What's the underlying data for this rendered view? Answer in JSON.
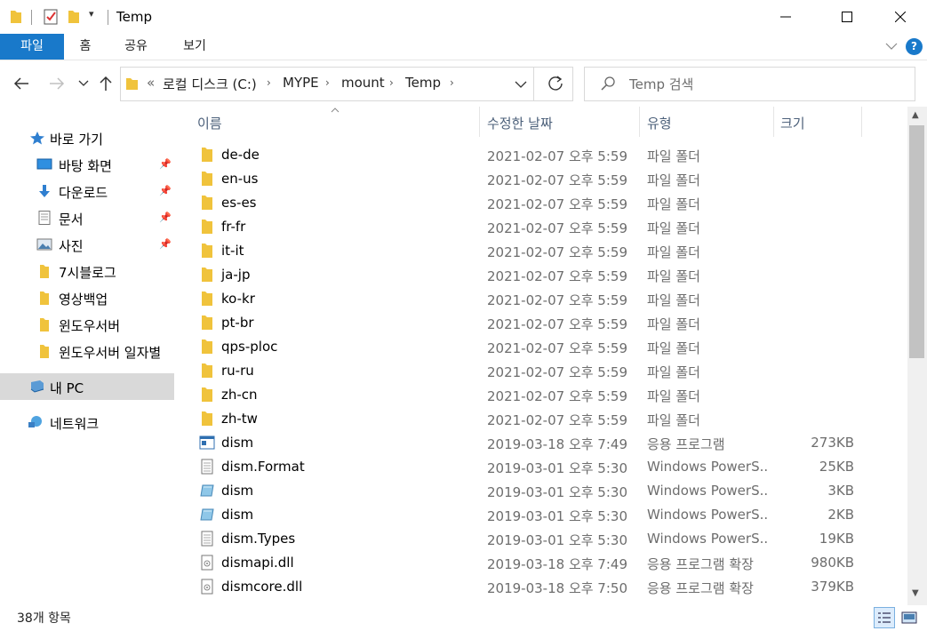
{
  "window": {
    "title": "Temp"
  },
  "ribbon": {
    "tabs": [
      "파일",
      "홈",
      "공유",
      "보기"
    ],
    "help": "?"
  },
  "address": {
    "overflow": "«",
    "crumbs": [
      "로컬 디스크 (C:)",
      "MYPE",
      "mount",
      "Temp"
    ]
  },
  "search": {
    "placeholder": "Temp 검색"
  },
  "sidebar": {
    "items": [
      {
        "label": "바로 가기",
        "icon": "star-icon",
        "pinned": false
      },
      {
        "label": "바탕 화면",
        "icon": "desktop-icon",
        "pinned": true
      },
      {
        "label": "다운로드",
        "icon": "download-icon",
        "pinned": true
      },
      {
        "label": "문서",
        "icon": "document-icon",
        "pinned": true
      },
      {
        "label": "사진",
        "icon": "picture-icon",
        "pinned": true
      },
      {
        "label": "7시블로그",
        "icon": "folder-icon",
        "pinned": false
      },
      {
        "label": "영상백업",
        "icon": "folder-icon",
        "pinned": false
      },
      {
        "label": "윈도우서버",
        "icon": "folder-icon",
        "pinned": false
      },
      {
        "label": "윈도우서버 일자별",
        "icon": "folder-icon",
        "pinned": false
      },
      {
        "label": "내 PC",
        "icon": "computer-icon",
        "pinned": false
      },
      {
        "label": "네트워크",
        "icon": "network-icon",
        "pinned": false
      }
    ]
  },
  "columns": {
    "name": "이름",
    "date": "수정한 날짜",
    "type": "유형",
    "size": "크기"
  },
  "files": [
    {
      "name": "de-de",
      "date": "2021-02-07 오후 5:59",
      "type": "파일 폴더",
      "size": "",
      "icon": "folder-icon"
    },
    {
      "name": "en-us",
      "date": "2021-02-07 오후 5:59",
      "type": "파일 폴더",
      "size": "",
      "icon": "folder-icon"
    },
    {
      "name": "es-es",
      "date": "2021-02-07 오후 5:59",
      "type": "파일 폴더",
      "size": "",
      "icon": "folder-icon"
    },
    {
      "name": "fr-fr",
      "date": "2021-02-07 오후 5:59",
      "type": "파일 폴더",
      "size": "",
      "icon": "folder-icon"
    },
    {
      "name": "it-it",
      "date": "2021-02-07 오후 5:59",
      "type": "파일 폴더",
      "size": "",
      "icon": "folder-icon"
    },
    {
      "name": "ja-jp",
      "date": "2021-02-07 오후 5:59",
      "type": "파일 폴더",
      "size": "",
      "icon": "folder-icon"
    },
    {
      "name": "ko-kr",
      "date": "2021-02-07 오후 5:59",
      "type": "파일 폴더",
      "size": "",
      "icon": "folder-icon"
    },
    {
      "name": "pt-br",
      "date": "2021-02-07 오후 5:59",
      "type": "파일 폴더",
      "size": "",
      "icon": "folder-icon"
    },
    {
      "name": "qps-ploc",
      "date": "2021-02-07 오후 5:59",
      "type": "파일 폴더",
      "size": "",
      "icon": "folder-icon"
    },
    {
      "name": "ru-ru",
      "date": "2021-02-07 오후 5:59",
      "type": "파일 폴더",
      "size": "",
      "icon": "folder-icon"
    },
    {
      "name": "zh-cn",
      "date": "2021-02-07 오후 5:59",
      "type": "파일 폴더",
      "size": "",
      "icon": "folder-icon"
    },
    {
      "name": "zh-tw",
      "date": "2021-02-07 오후 5:59",
      "type": "파일 폴더",
      "size": "",
      "icon": "folder-icon"
    },
    {
      "name": "dism",
      "date": "2019-03-18 오후 7:49",
      "type": "응용 프로그램",
      "size": "273KB",
      "icon": "application-icon"
    },
    {
      "name": "dism.Format",
      "date": "2019-03-01 오후 5:30",
      "type": "Windows PowerS...",
      "size": "25KB",
      "icon": "text-file-icon"
    },
    {
      "name": "dism",
      "date": "2019-03-01 오후 5:30",
      "type": "Windows PowerS...",
      "size": "3KB",
      "icon": "powershell-file-icon"
    },
    {
      "name": "dism",
      "date": "2019-03-01 오후 5:30",
      "type": "Windows PowerS...",
      "size": "2KB",
      "icon": "powershell-file-icon"
    },
    {
      "name": "dism.Types",
      "date": "2019-03-01 오후 5:30",
      "type": "Windows PowerS...",
      "size": "19KB",
      "icon": "text-file-icon"
    },
    {
      "name": "dismapi.dll",
      "date": "2019-03-18 오후 7:49",
      "type": "응용 프로그램 확장",
      "size": "980KB",
      "icon": "dll-file-icon"
    },
    {
      "name": "dismcore.dll",
      "date": "2019-03-18 오후 7:50",
      "type": "응용 프로그램 확장",
      "size": "379KB",
      "icon": "dll-file-icon"
    }
  ],
  "status": {
    "count": "38개 항목"
  },
  "colors": {
    "accent": "#1979ca",
    "folder": "#f0c33c",
    "selected": "#d9d9d9"
  }
}
